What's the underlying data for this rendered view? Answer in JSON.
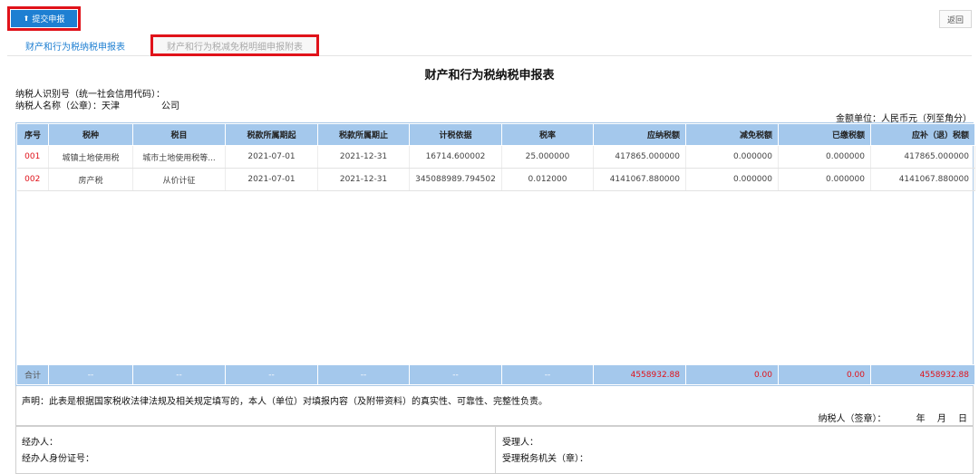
{
  "toolbar": {
    "submit_label": "提交申报",
    "back_label": "返回"
  },
  "tabs": [
    {
      "label": "财产和行为税纳税申报表"
    },
    {
      "label": "财产和行为税减免税明细申报附表"
    }
  ],
  "form": {
    "title": "财产和行为税纳税申报表",
    "taxpayer_id_label": "纳税人识别号（统一社会信用代码）：",
    "taxpayer_name_label": "纳税人名称（公章）：天津",
    "taxpayer_name_suffix": "公司",
    "unit_label": "金额单位：人民币元（列至角分）"
  },
  "table": {
    "headers": [
      "序号",
      "税种",
      "税目",
      "税款所属期起",
      "税款所属期止",
      "计税依据",
      "税率",
      "应纳税额",
      "减免税额",
      "已缴税额",
      "应补（退）税额"
    ],
    "rows": [
      [
        "001",
        "城镇土地使用税",
        "城市土地使用税等...",
        "2021-07-01",
        "2021-12-31",
        "16714.600002",
        "25.000000",
        "417865.000000",
        "0.000000",
        "0.000000",
        "417865.000000"
      ],
      [
        "002",
        "房产税",
        "从价计征",
        "2021-07-01",
        "2021-12-31",
        "345088989.794502",
        "0.012000",
        "4141067.880000",
        "0.000000",
        "0.000000",
        "4141067.880000"
      ]
    ],
    "total": [
      "合计",
      "--",
      "--",
      "--",
      "--",
      "--",
      "--",
      "4558932.88",
      "0.00",
      "0.00",
      "4558932.88"
    ]
  },
  "declaration": {
    "text": "声明：此表是根据国家税收法律法规及相关规定填写的，本人（单位）对填报内容（及附带资料）的真实性、可靠性、完整性负责。",
    "sign_label": "纳税人（签章）：",
    "date_label": "年 月 日"
  },
  "agent": {
    "handler_label": "经办人：",
    "handler_id_label": "经办人身份证号：",
    "receiver_label": "受理人：",
    "office_label": "受理税务机关（章）："
  },
  "colors": {
    "accent": "#1e7fd2",
    "highlight_border": "#e0121a",
    "header_bg": "#a4c8ec"
  }
}
